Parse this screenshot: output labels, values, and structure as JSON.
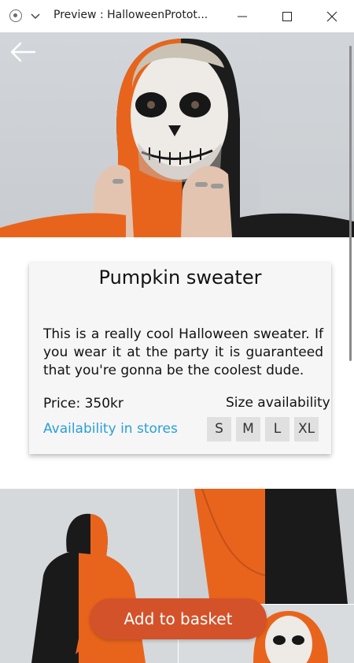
{
  "window": {
    "title": "Preview : HalloweenProtot...",
    "icons": [
      "record-icon",
      "chevron-down-icon",
      "minimize-icon",
      "maximize-icon",
      "close-icon"
    ]
  },
  "nav": {
    "back_icon": "arrow-left-icon"
  },
  "product": {
    "name": "Pumpkin sweater",
    "description": "This is a really cool Halloween sweater. If you wear it at the party it is guaranteed that you're gonna be the coolest dude.",
    "price": "Price: 350kr",
    "availability_link": "Availability in stores",
    "size_label": "Size availability",
    "sizes": [
      "S",
      "M",
      "L",
      "XL"
    ]
  },
  "actions": {
    "add_to_basket": "Add to basket"
  },
  "colors": {
    "accent": "#d4522a",
    "link": "#2a9fd8",
    "card_bg": "#f6f6f6",
    "size_button_bg": "#e0e0e0",
    "sweater_orange": "#e8641c",
    "sweater_black": "#1a1a1a"
  }
}
